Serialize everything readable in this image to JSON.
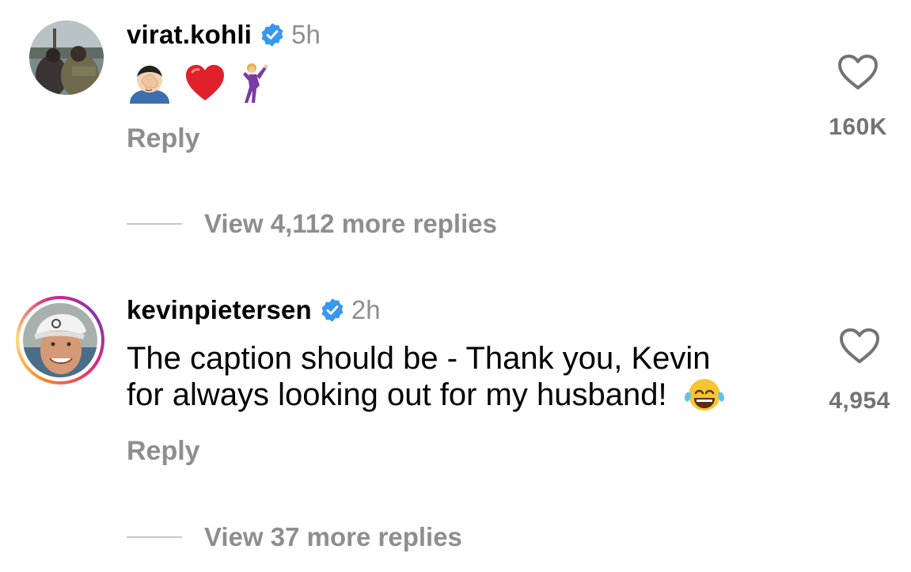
{
  "comments": [
    {
      "username": "virat.kohli",
      "verified": true,
      "time": "5h",
      "text": "",
      "emojis": [
        "face-palm",
        "red-heart",
        "dancing-man"
      ],
      "reply_label": "Reply",
      "like_count": "160K",
      "view_replies": "View 4,112 more replies",
      "story_ring": false
    },
    {
      "username": "kevinpietersen",
      "verified": true,
      "time": "2h",
      "text_line1": "The caption should be - Thank you, Kevin",
      "text_line2": "for always looking out for my husband!",
      "emojis": [
        "face-with-tears-of-joy"
      ],
      "reply_label": "Reply",
      "like_count": "4,954",
      "view_replies": "View 37 more replies",
      "story_ring": true
    }
  ],
  "colors": {
    "verified": "#3897f0",
    "secondary_text": "#8e8e8e",
    "like_count": "#737373",
    "divider": "#c7c7c7"
  }
}
